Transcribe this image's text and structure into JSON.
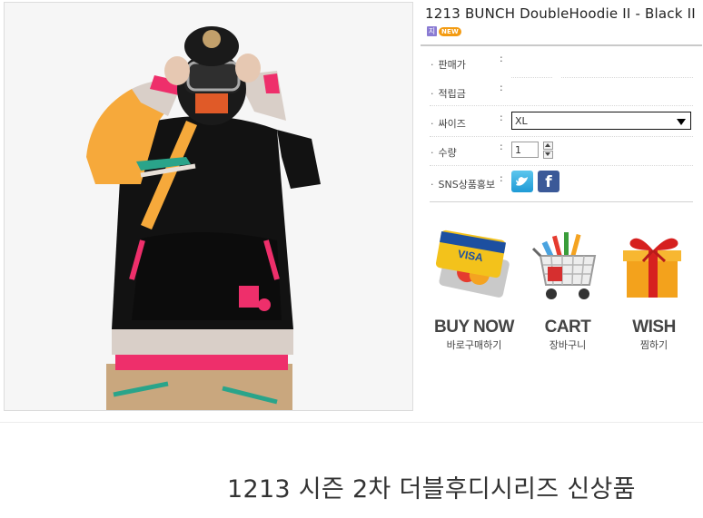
{
  "product": {
    "title": "1213 BUNCH DoubleHoodie II - Black II",
    "badge_ji": "지",
    "badge_new": "NEW"
  },
  "info_rows": {
    "price_label": "판매가",
    "points_label": "적립금",
    "size_label": "싸이즈",
    "qty_label": "수량",
    "sns_label": "SNS상품홍보"
  },
  "size_select": {
    "value": "XL"
  },
  "quantity": {
    "value": "1"
  },
  "actions": {
    "buy": {
      "title": "BUY NOW",
      "subtitle": "바로구매하기"
    },
    "cart": {
      "title": "CART",
      "subtitle": "장바구니"
    },
    "wish": {
      "title": "WISH",
      "subtitle": "찜하기"
    }
  },
  "headline": "1213 시즌 2차 더블후디시리즈 신상품",
  "colors": {
    "accent_pink": "#ee2f6b",
    "accent_orange": "#f6a93b",
    "facebook": "#3b5998",
    "twitter": "#1e9ad6"
  }
}
